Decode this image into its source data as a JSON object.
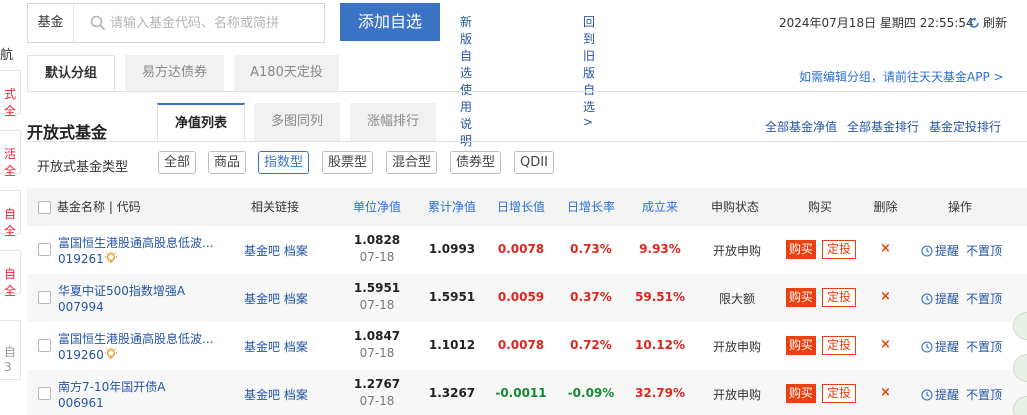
{
  "leftbar": {
    "nav_text": "航",
    "tab_chars": [
      "式\n全",
      "活\n全",
      "自\n全",
      "自\n全",
      "自\n全",
      "自"
    ]
  },
  "search": {
    "type_label": "基金",
    "placeholder": "请输入基金代码、名称或简拼"
  },
  "top": {
    "add_button": "添加自选",
    "link_new_guide": "新版自选使用说明>",
    "link_old_version": "回到旧版自选>",
    "datetime": "2024年07月18日 星期四 22:55:54",
    "refresh": "刷新"
  },
  "group_tabs": [
    "默认分组",
    "易方达债券",
    "A180天定投"
  ],
  "group_link": "如需编辑分组，请前往天天基金APP >",
  "section": {
    "title": "开放式基金",
    "view_tabs": [
      "净值列表",
      "多图同列",
      "涨幅排行"
    ],
    "right_links": [
      "全部基金净值",
      "全部基金排行",
      "基金定投排行"
    ]
  },
  "filter": {
    "label": "开放式基金类型",
    "chips": [
      "全部",
      "商品",
      "指数型",
      "股票型",
      "混合型",
      "债券型",
      "QDII"
    ],
    "active": "指数型"
  },
  "colors": {
    "accent": "#3a73c4",
    "up": "#e0261c",
    "down": "#128b2e",
    "buy": "#e8410f"
  },
  "chart_data": {
    "type": "table",
    "columns": [
      "基金名称 | 代码",
      "相关链接",
      "单位净值",
      "累计净值",
      "日增长值",
      "日增长率",
      "成立来",
      "申购状态",
      "购买",
      "删除",
      "操作"
    ],
    "rows": [
      {
        "name": "富国恒生港股通高股息低波...",
        "code": "019261",
        "has_bulb": true,
        "links": "基金吧 档案",
        "unit_nav": "1.0828",
        "nav_date": "07-18",
        "acc_nav": "1.0993",
        "daily_change": "0.0078",
        "daily_rate": "0.73%",
        "since_inception": "9.93%",
        "status": "开放申购",
        "buy": "购买",
        "fixed": "定投",
        "delete": "×",
        "remind": "提醒",
        "unpin": "不置顶"
      },
      {
        "name": "华夏中证500指数增强A",
        "code": "007994",
        "has_bulb": false,
        "links": "基金吧 档案",
        "unit_nav": "1.5951",
        "nav_date": "07-18",
        "acc_nav": "1.5951",
        "daily_change": "0.0059",
        "daily_rate": "0.37%",
        "since_inception": "59.51%",
        "status": "限大额",
        "buy": "购买",
        "fixed": "定投",
        "delete": "×",
        "remind": "提醒",
        "unpin": "不置顶"
      },
      {
        "name": "富国恒生港股通高股息低波...",
        "code": "019260",
        "has_bulb": true,
        "links": "基金吧 档案",
        "unit_nav": "1.0847",
        "nav_date": "07-18",
        "acc_nav": "1.1012",
        "daily_change": "0.0078",
        "daily_rate": "0.72%",
        "since_inception": "10.12%",
        "status": "开放申购",
        "buy": "购买",
        "fixed": "定投",
        "delete": "×",
        "remind": "提醒",
        "unpin": "不置顶"
      },
      {
        "name": "南方7-10年国开债A",
        "code": "006961",
        "has_bulb": false,
        "links": "基金吧 档案",
        "unit_nav": "1.2767",
        "nav_date": "07-18",
        "acc_nav": "1.3267",
        "daily_change": "-0.0011",
        "daily_rate": "-0.09%",
        "since_inception": "32.79%",
        "status": "开放申购",
        "buy": "购买",
        "fixed": "定投",
        "delete": "×",
        "remind": "提醒",
        "unpin": "不置顶"
      }
    ]
  }
}
